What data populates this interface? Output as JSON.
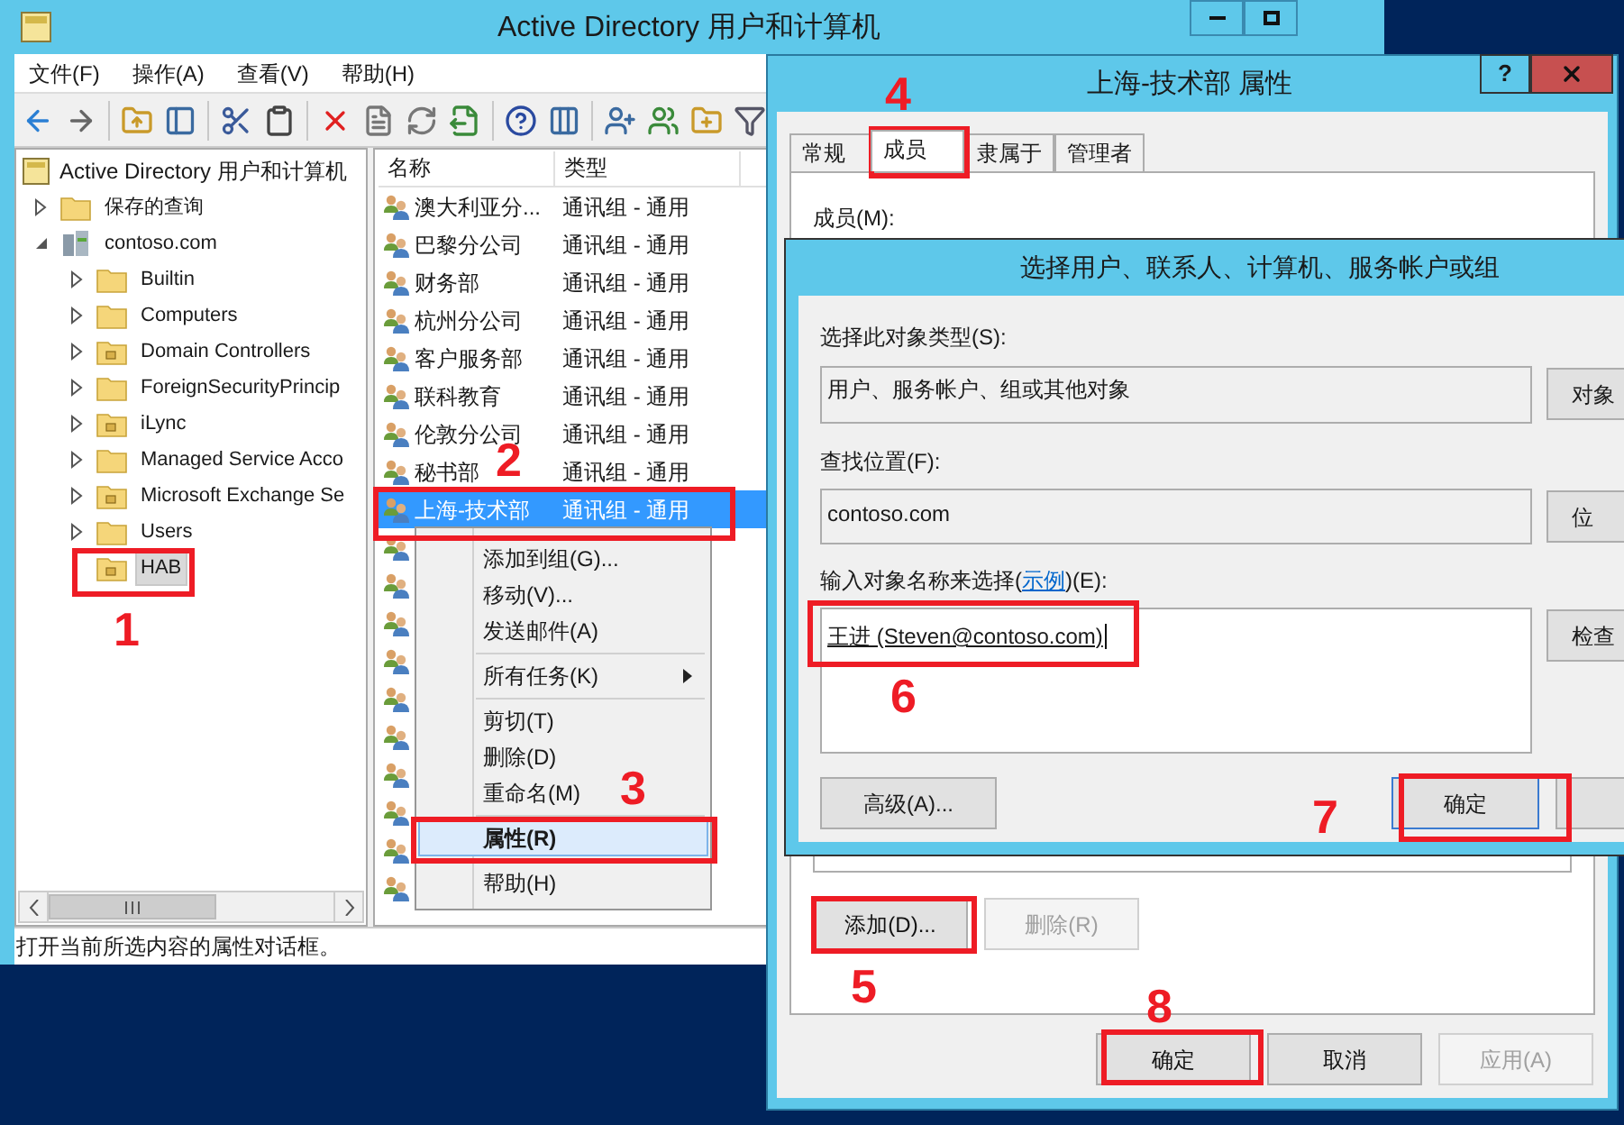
{
  "main_window": {
    "title": "Active Directory 用户和计算机",
    "menu": [
      "文件(F)",
      "操作(A)",
      "查看(V)",
      "帮助(H)"
    ],
    "tree": {
      "label": "Active Directory 用户和计算机",
      "children": [
        {
          "label": "保存的查询",
          "kind": "container",
          "expanded": false,
          "has_children": true,
          "selected": false
        },
        {
          "label": "contoso.com",
          "kind": "domain",
          "expanded": true,
          "has_children": true,
          "selected": false,
          "children": [
            {
              "label": "Builtin",
              "kind": "container",
              "expanded": false,
              "has_children": true,
              "selected": false
            },
            {
              "label": "Computers",
              "kind": "container",
              "expanded": false,
              "has_children": true,
              "selected": false
            },
            {
              "label": "Domain Controllers",
              "kind": "ou",
              "expanded": false,
              "has_children": true,
              "selected": false
            },
            {
              "label": "ForeignSecurityPrincip",
              "kind": "container",
              "expanded": false,
              "has_children": true,
              "selected": false
            },
            {
              "label": "iLync",
              "kind": "ou",
              "expanded": false,
              "has_children": true,
              "selected": false
            },
            {
              "label": "Managed Service Acco",
              "kind": "container",
              "expanded": false,
              "has_children": true,
              "selected": false
            },
            {
              "label": "Microsoft Exchange Se",
              "kind": "ou",
              "expanded": false,
              "has_children": true,
              "selected": false
            },
            {
              "label": "Users",
              "kind": "container",
              "expanded": false,
              "has_children": true,
              "selected": false
            },
            {
              "label": "HAB",
              "kind": "ou",
              "expanded": false,
              "has_children": false,
              "selected": true
            }
          ]
        }
      ]
    },
    "list": {
      "columns": [
        "名称",
        "类型"
      ],
      "rows": [
        {
          "name": "澳大利亚分...",
          "type": "通讯组 - 通用",
          "selected": false
        },
        {
          "name": "巴黎分公司",
          "type": "通讯组 - 通用",
          "selected": false
        },
        {
          "name": "财务部",
          "type": "通讯组 - 通用",
          "selected": false
        },
        {
          "name": "杭州分公司",
          "type": "通讯组 - 通用",
          "selected": false
        },
        {
          "name": "客户服务部",
          "type": "通讯组 - 通用",
          "selected": false
        },
        {
          "name": "联科教育",
          "type": "通讯组 - 通用",
          "selected": false
        },
        {
          "name": "伦敦分公司",
          "type": "通讯组 - 通用",
          "selected": false
        },
        {
          "name": "秘书部",
          "type": "通讯组 - 通用",
          "selected": false
        },
        {
          "name": "上海-技术部",
          "type": "通讯组 - 通用",
          "selected": true
        }
      ],
      "covered_rows": [
        {
          "kind": "group"
        },
        {
          "kind": "group"
        },
        {
          "kind": "group"
        },
        {
          "kind": "group"
        },
        {
          "kind": "group"
        },
        {
          "kind": "group"
        },
        {
          "kind": "group"
        },
        {
          "kind": "group"
        },
        {
          "kind": "group"
        },
        {
          "kind": "group"
        }
      ]
    },
    "context_menu": [
      {
        "kind": "item",
        "label": "添加到组(G)...",
        "selected": false,
        "default": false
      },
      {
        "kind": "item",
        "label": "移动(V)...",
        "selected": false,
        "default": false
      },
      {
        "kind": "item",
        "label": "发送邮件(A)",
        "selected": false,
        "default": false
      },
      {
        "kind": "separator"
      },
      {
        "kind": "submenu",
        "label": "所有任务(K)",
        "selected": false,
        "default": false
      },
      {
        "kind": "separator"
      },
      {
        "kind": "item",
        "label": "剪切(T)",
        "selected": false,
        "default": false
      },
      {
        "kind": "item",
        "label": "删除(D)",
        "selected": false,
        "default": false
      },
      {
        "kind": "item",
        "label": "重命名(M)",
        "selected": false,
        "default": false
      },
      {
        "kind": "separator"
      },
      {
        "kind": "item",
        "label": "属性(R)",
        "selected": true,
        "default": true
      },
      {
        "kind": "separator"
      },
      {
        "kind": "item",
        "label": "帮助(H)",
        "selected": false,
        "default": false
      }
    ],
    "status_bar": "打开当前所选内容的属性对话框。"
  },
  "properties_dialog": {
    "title": "上海-技术部 属性",
    "help_button": "?",
    "tabs": [
      {
        "label": "常规",
        "selected": false
      },
      {
        "label": "成员",
        "selected": true
      },
      {
        "label": "隶属于",
        "selected": false
      },
      {
        "label": "管理者",
        "selected": false
      }
    ],
    "members_label": "成员(M):",
    "buttons": [
      {
        "label": "添加(D)...",
        "disabled": false
      },
      {
        "label": "删除(R)",
        "disabled": true
      }
    ],
    "footer_buttons": [
      {
        "label": "确定",
        "disabled": false
      },
      {
        "label": "取消",
        "disabled": false
      },
      {
        "label": "应用(A)",
        "disabled": true
      }
    ]
  },
  "select_dialog": {
    "title": "选择用户、联系人、计算机、服务帐户或组",
    "object_type_label": "选择此对象类型(S):",
    "object_type_value": "用户、服务帐户、组或其他对象",
    "object_type_button": "对象",
    "location_label": "查找位置(F):",
    "location_value": "contoso.com",
    "location_button": "位",
    "names_label_before": "输入对象名称来选择(",
    "names_link": "示例",
    "names_label_after": ")(E):",
    "names_value": "王进 (Steven@contoso.com)",
    "check_button": "检查",
    "advanced_button": "高级(A)...",
    "ok_button": "确定"
  },
  "annotations": [
    {
      "label": "1"
    },
    {
      "label": "2"
    },
    {
      "label": "3"
    },
    {
      "label": "4"
    },
    {
      "label": "5"
    },
    {
      "label": "6"
    },
    {
      "label": "7"
    },
    {
      "label": "8"
    }
  ]
}
